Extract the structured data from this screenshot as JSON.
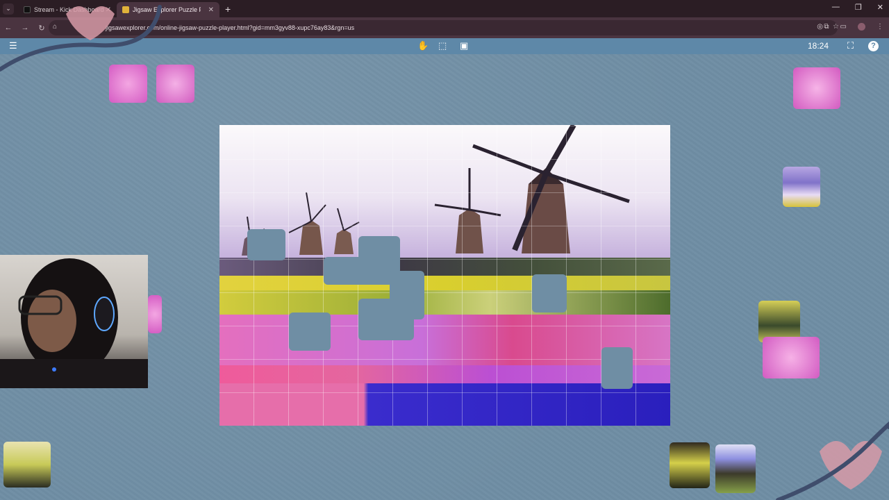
{
  "browser": {
    "tabs": [
      {
        "title": "Stream - Kick Dashboard",
        "active": false
      },
      {
        "title": "Jigsaw Explorer Puzzle Player",
        "active": true
      }
    ],
    "url": "jigsawexplorer.com/online-jigsaw-puzzle-player.html?gid=mm3gyv88-xupc76ay83&rgn=us",
    "new_tab_label": "+"
  },
  "app": {
    "timer": "18:24",
    "icons": {
      "menu": "menu-icon",
      "grab": "hand-icon",
      "select": "select-box-icon",
      "preview": "image-icon",
      "fullscreen": "fullscreen-icon",
      "help": "help-icon"
    }
  },
  "colors": {
    "board": "#6f8ea4",
    "toolbar": "#5e88a8",
    "tabbar": "#2b1d24",
    "addressbar": "#4a3440"
  }
}
